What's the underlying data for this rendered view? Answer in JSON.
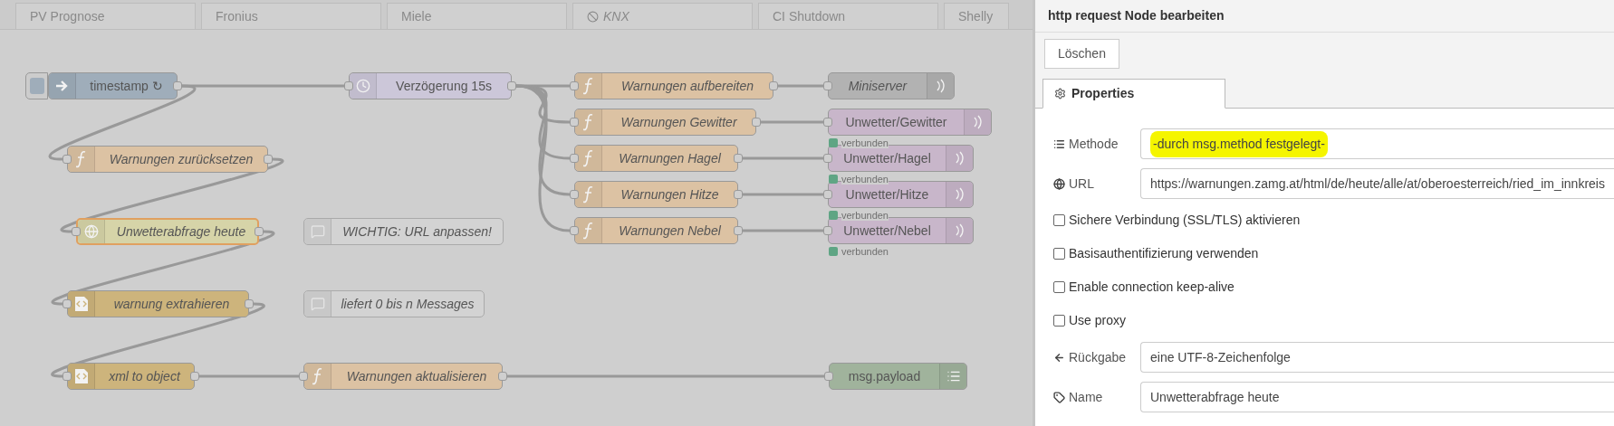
{
  "workspace_tabs": [
    {
      "label": "PV Prognose",
      "disabled": false
    },
    {
      "label": "Fronius",
      "disabled": false
    },
    {
      "label": "Miele",
      "disabled": false
    },
    {
      "label": "KNX",
      "disabled": true
    },
    {
      "label": "CI Shutdown",
      "disabled": false
    },
    {
      "label": "Shelly",
      "disabled": false
    }
  ],
  "nodes": [
    {
      "kind": "inject",
      "label": "timestamp ↻",
      "italic": false,
      "selected": false
    },
    {
      "kind": "delay",
      "label": "Verzögerung 15s",
      "italic": false,
      "selected": false
    },
    {
      "kind": "function",
      "label": "Warnungen zurücksetzen",
      "italic": true,
      "selected": false
    },
    {
      "kind": "http",
      "label": "Unwetterabfrage heute",
      "italic": true,
      "selected": true
    },
    {
      "kind": "comment",
      "label": "WICHTIG: URL anpassen!",
      "italic": true,
      "selected": false
    },
    {
      "kind": "template",
      "label": "warnung extrahieren",
      "italic": true,
      "selected": false
    },
    {
      "kind": "comment",
      "label": "liefert 0 bis n Messages",
      "italic": true,
      "selected": false
    },
    {
      "kind": "xml",
      "label": "xml to object",
      "italic": true,
      "selected": false
    },
    {
      "kind": "function",
      "label": "Warnungen aktualisieren",
      "italic": true,
      "selected": false
    },
    {
      "kind": "function",
      "label": "Warnungen aufbereiten",
      "italic": true,
      "selected": false
    },
    {
      "kind": "function",
      "label": "Warnungen Gewitter",
      "italic": true,
      "selected": false
    },
    {
      "kind": "function",
      "label": "Warnungen Hagel",
      "italic": true,
      "selected": false
    },
    {
      "kind": "function",
      "label": "Warnungen Hitze",
      "italic": true,
      "selected": false
    },
    {
      "kind": "function",
      "label": "Warnungen Nebel",
      "italic": true,
      "selected": false
    },
    {
      "kind": "output",
      "label": "Miniserver",
      "italic": true,
      "selected": false
    },
    {
      "kind": "mqtt",
      "label": "Unwetter/Gewitter",
      "italic": false,
      "selected": false,
      "status": {
        "text": "verbunden"
      }
    },
    {
      "kind": "mqtt",
      "label": "Unwetter/Hagel",
      "italic": false,
      "selected": false,
      "status": {
        "text": "verbunden"
      }
    },
    {
      "kind": "mqtt",
      "label": "Unwetter/Hitze",
      "italic": false,
      "selected": false,
      "status": {
        "text": "verbunden"
      }
    },
    {
      "kind": "mqtt",
      "label": "Unwetter/Nebel",
      "italic": false,
      "selected": false,
      "status": {
        "text": "verbunden"
      }
    },
    {
      "kind": "debug",
      "label": "msg.payload",
      "italic": false,
      "selected": false
    }
  ],
  "edit_panel": {
    "title": "http request Node bearbeiten",
    "delete_button": "Löschen",
    "tabs": [
      {
        "label": "Properties",
        "selected": true
      }
    ],
    "fields": [
      {
        "kind": "input",
        "label": "Methode",
        "value": "-durch msg.method festgelegt-",
        "highlighted": true
      },
      {
        "kind": "input",
        "label": "URL",
        "value": "https://warnungen.zamg.at/html/de/heute/alle/at/oberoesterreich/ried_im_innkreis",
        "highlighted": false
      },
      {
        "kind": "checkbox",
        "label": "Sichere Verbindung (SSL/TLS) aktivieren",
        "checked": false
      },
      {
        "kind": "checkbox",
        "label": "Basisauthentifizierung verwenden",
        "checked": false
      },
      {
        "kind": "checkbox",
        "label": "Enable connection keep-alive",
        "checked": false
      },
      {
        "kind": "checkbox",
        "label": "Use proxy",
        "checked": false
      },
      {
        "kind": "input",
        "label": "Rückgabe",
        "value": "eine UTF-8-Zeichenfolge",
        "highlighted": false
      },
      {
        "kind": "input",
        "label": "Name",
        "value": "Unwetterabfrage heute",
        "highlighted": false
      }
    ]
  }
}
